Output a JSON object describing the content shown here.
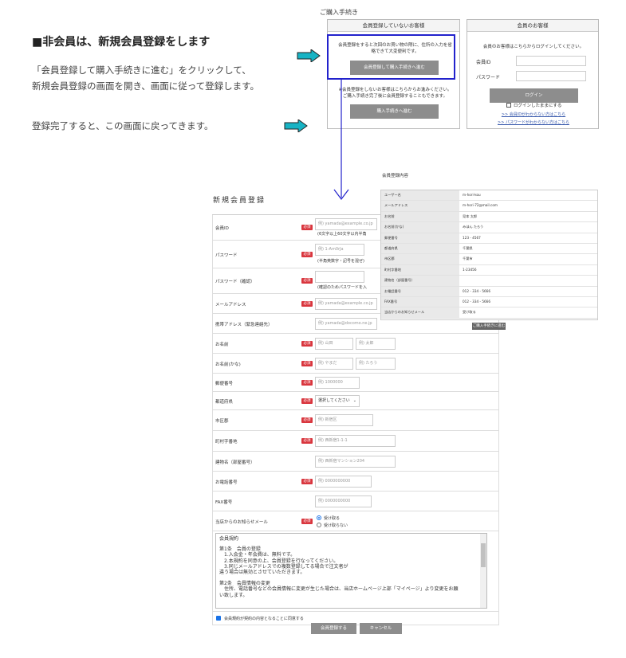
{
  "instructions": {
    "heading": "■非会員は、新規会員登録をします",
    "line1": "「会員登録して購入手続きに進む」をクリックして、",
    "line2": "新規会員登録の画面を開き、画面に従って登録します。",
    "line3": "登録完了すると、この画面に戻ってきます。"
  },
  "checkout": {
    "title": "ご購入手続き",
    "guest_panel": {
      "header": "会員登録していないお客様",
      "text1": "会員登録をすると次回のお買い物の際に、住所の入力を省略できて大変便利です。",
      "register_button": "会員登録して購入手続きへ進む",
      "text2": "※会員登録をしないお客様はこちらからお進みください。ご購入手続き完了後に会員登録することもできます。",
      "guest_button": "購入手続きへ進む"
    },
    "member_panel": {
      "header": "会員のお客様",
      "intro": "会員のお客様はこちらからログインしてください。",
      "id_label": "会員ID",
      "password_label": "パスワード",
      "login_button": "ログイン",
      "remember_label": "ログインしたままにする",
      "forgot_id_link": ">> 会員IDがわからない方はこちら",
      "forgot_pw_link": ">> パスワードがわからない方はこちら"
    }
  },
  "form": {
    "title": "新規会員登録",
    "required_badge": "必須",
    "member_id": {
      "label": "会員ID",
      "placeholder": "例) yamada@example.co.jp",
      "note": "(6文字以上60文字以内半角"
    },
    "password": {
      "label": "パスワード",
      "placeholder": "例) 1-Am0rJa",
      "note": "(半角英数字・記号を混ぜ)"
    },
    "password_confirm": {
      "label": "パスワード（確認）",
      "note": "(確認のためパスワードを入"
    },
    "email": {
      "label": "メールアドレス",
      "placeholder": "例) yamada@example.co.jp"
    },
    "mobile_email": {
      "label": "携帯アドレス（緊急連絡先）",
      "placeholder": "例) yamada@docomo.ne.jp"
    },
    "name": {
      "label": "お名前",
      "last_placeholder": "例) 山田",
      "first_placeholder": "例) 太郎"
    },
    "name_kana": {
      "label": "お名前(かな)",
      "last_placeholder": "例) やまだ",
      "first_placeholder": "例) たろう"
    },
    "zip": {
      "label": "郵便番号",
      "placeholder": "例) 1000000"
    },
    "prefecture": {
      "label": "都道府県",
      "value": "選択してください"
    },
    "city": {
      "label": "市区郡",
      "placeholder": "例) 新宿区"
    },
    "town": {
      "label": "町村字番地",
      "placeholder": "例) 西新宿1-1-1"
    },
    "building": {
      "label": "建物名（部屋番号）",
      "placeholder": "例) 西新宿マンション204"
    },
    "phone": {
      "label": "お電話番号",
      "placeholder": "例) 0000000000"
    },
    "fax": {
      "label": "FAX番号",
      "placeholder": "例) 0000000000"
    },
    "newsletter": {
      "label": "当店からのお知らせメール",
      "option_yes": "受け取る",
      "option_no": "受け取らない"
    },
    "terms": {
      "title": "会員規約",
      "lines": [
        "第1条　会員の登録",
        "　1.入会金・年会費は、無料です。",
        "　2.本規約を同意の上、会員登録を行なってください。",
        "　3.同じメールアドレスでの複数登録してる場合で注文者が",
        "違う場合は無効とさせていただきます。",
        "",
        "第2条　会員情報の変更",
        "　住所、電話番号などの会員情報に変更が生じた場合は、当店ホームページ上部「マイページ」より変更をお願",
        "い致します。"
      ]
    },
    "agree_label": "会員規約が契約の内容となることに同意する",
    "submit_button": "会員登録する",
    "cancel_button": "キャンセル"
  },
  "confirmation": {
    "title": "会員登録内容",
    "rows": [
      {
        "key": "ユーザー名",
        "value": "m-hori-kou"
      },
      {
        "key": "メールアドレス",
        "value": "m-hori-72@mail.com"
      },
      {
        "key": "お名前",
        "value": "見本 太郎"
      },
      {
        "key": "お名前(かな)",
        "value": "みほん たろう"
      },
      {
        "key": "郵便番号",
        "value": "123 - 4567"
      },
      {
        "key": "都道府県",
        "value": "千葉県"
      },
      {
        "key": "市区郡",
        "value": "千葉市"
      },
      {
        "key": "町村字番地",
        "value": "1-23456"
      },
      {
        "key": "建物名（部屋番号）",
        "value": ""
      },
      {
        "key": "お電話番号",
        "value": "012 - 334 - 5666"
      },
      {
        "key": "FAX番号",
        "value": "012 - 334 - 5666"
      },
      {
        "key": "当店からのお知らせメール",
        "value": "受け取る"
      }
    ],
    "button": "ご購入手続きに進む"
  },
  "colors": {
    "arrow": "#17b3c4",
    "connector": "#2222cc",
    "required": "#d9363e",
    "button": "#8d8d8d"
  }
}
